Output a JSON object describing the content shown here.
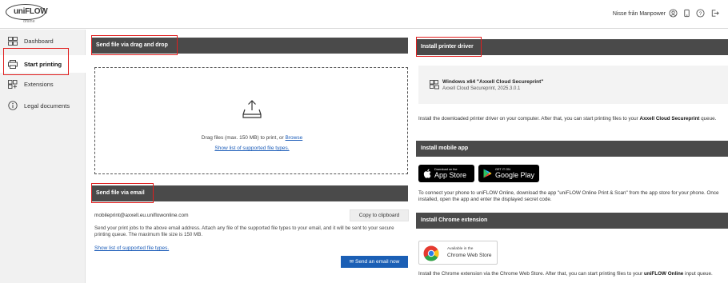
{
  "header": {
    "logo_main": "uniFLOW",
    "logo_sub": "online",
    "user_name": "Nisse från Manpower",
    "icons": [
      "user-circle-icon",
      "device-icon",
      "help-icon",
      "logout-icon"
    ]
  },
  "sidebar": {
    "items": [
      {
        "label": "Dashboard",
        "icon": "dashboard-icon"
      },
      {
        "label": "Start printing",
        "icon": "printer-icon",
        "active": true
      },
      {
        "label": "Extensions",
        "icon": "extensions-icon"
      },
      {
        "label": "Legal documents",
        "icon": "info-icon"
      }
    ]
  },
  "drag_drop": {
    "title": "Send file via drag and drop",
    "drop_text": "Drag files (max. 150 MB) to print, or ",
    "browse_label": "Browse",
    "supported_link": "Show list of supported file types."
  },
  "email": {
    "title": "Send file via email",
    "address": "mobileprint@axxell.eu.uniflowonline.com",
    "copy_label": "Copy to clipboard",
    "description": "Send your print jobs to the above email address. Attach any file of the supported file types to your email, and it will be sent to your secure printing queue. The maximum file size is 150 MB.",
    "supported_link": "Show list of supported file types.",
    "send_label": "Send an email now"
  },
  "printer_driver": {
    "title": "Install printer driver",
    "driver_name": "Windows x64 \"Axxell Cloud Secureprint\"",
    "driver_version": "Axxell Cloud Secureprint, 2025.3.0.1",
    "desc_before": "Install the downloaded printer driver on your computer. After that, you can start printing files to your ",
    "desc_bold": "Axxell Cloud Secureprint",
    "desc_after": " queue."
  },
  "mobile_app": {
    "title": "Install mobile app",
    "appstore_small": "Download on the",
    "appstore_big": "App Store",
    "googleplay_small": "GET IT ON",
    "googleplay_big": "Google Play",
    "description": "To connect your phone to uniFLOW Online, download the app \"uniFLOW Online Print & Scan\" from the app store for your phone. Once installed, open the app and enter the displayed secret code."
  },
  "chrome_ext": {
    "title": "Install Chrome extension",
    "badge_small": "Available in the",
    "badge_big": "Chrome Web Store",
    "desc_before": "Install the Chrome extension via the Chrome Web Store. After that, you can start printing files to your ",
    "desc_bold": "uniFLOW Online",
    "desc_after": " input queue."
  },
  "colors": {
    "accent_blue": "#1b5fb5",
    "highlight_red": "#e01e1e",
    "section_bar": "#4a4a4a"
  }
}
